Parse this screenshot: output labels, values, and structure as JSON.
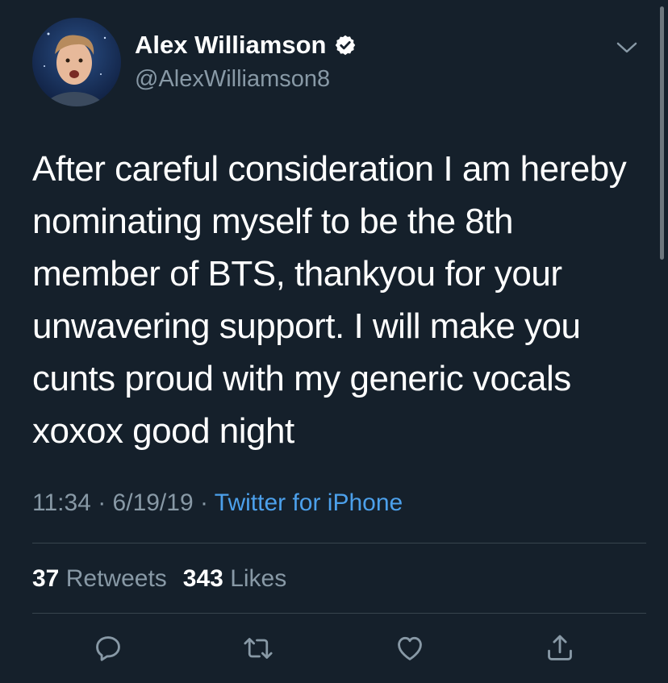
{
  "author": {
    "display_name": "Alex Williamson",
    "handle": "@AlexWilliamson8",
    "verified": true,
    "avatar_icon": "profile-photo"
  },
  "tweet": {
    "text": "After careful consideration I am hereby\nnominating myself to be the 8th\nmember of BTS, thankyou for your\nunwavering support. I will make you\ncunts proud with my generic vocals\nxoxox good night",
    "time": "11:34",
    "separator": "·",
    "date": "6/19/19",
    "source": "Twitter for iPhone"
  },
  "stats": {
    "retweets_count": "37",
    "retweets_label": "Retweets",
    "likes_count": "343",
    "likes_label": "Likes"
  },
  "actions": [
    {
      "icon": "reply-icon"
    },
    {
      "icon": "retweet-icon"
    },
    {
      "icon": "like-icon"
    },
    {
      "icon": "share-icon"
    }
  ],
  "colors": {
    "background": "#15202b",
    "secondary_text": "#8899a6",
    "link": "#4ca0eb",
    "divider": "#38444d",
    "verified_badge": "#ffffff"
  }
}
